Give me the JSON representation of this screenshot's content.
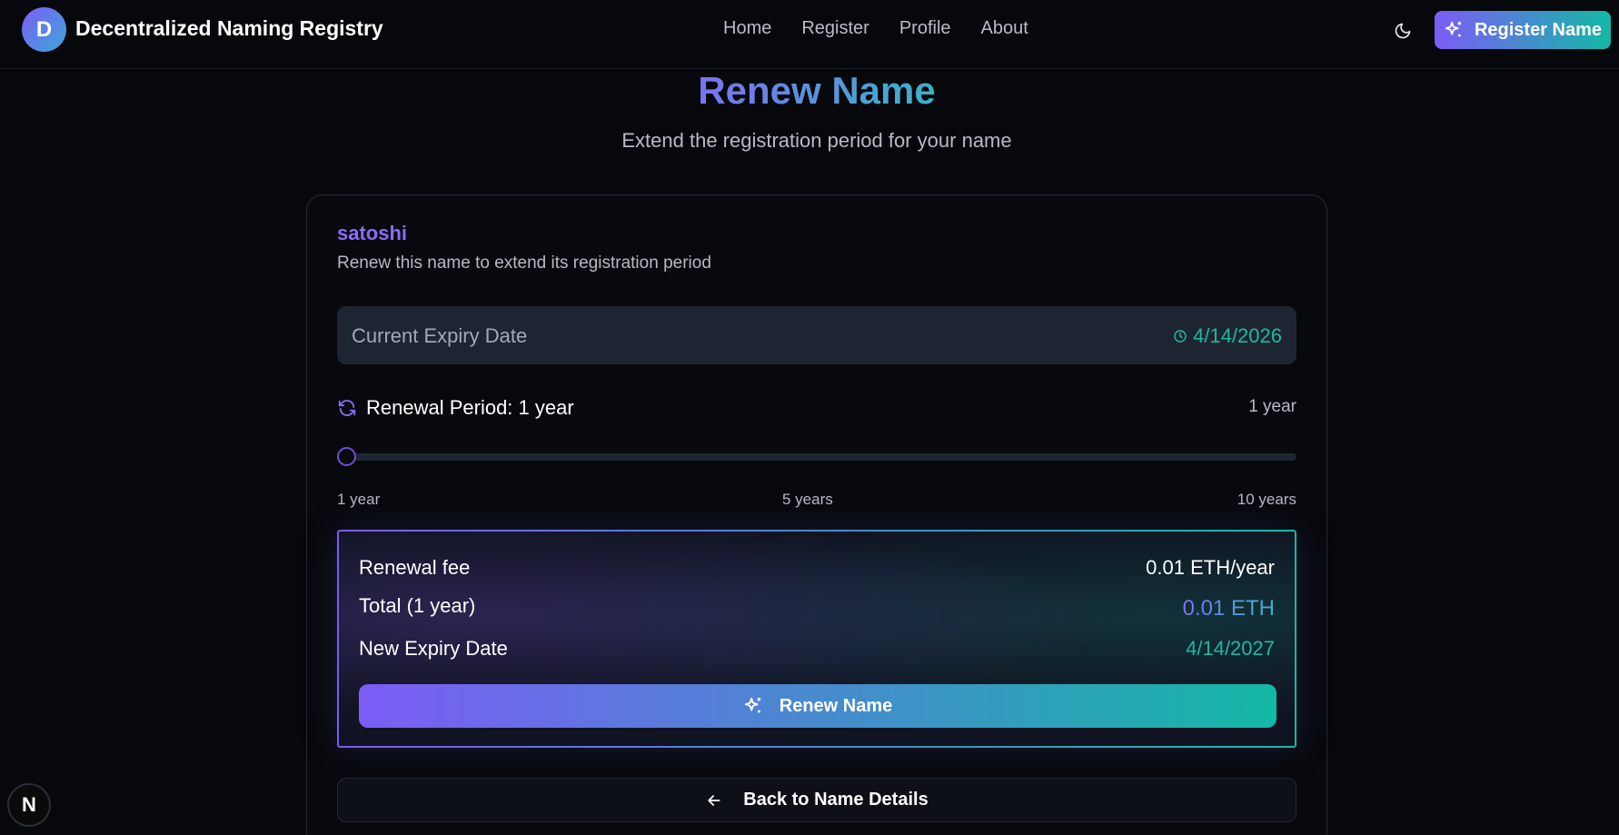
{
  "header": {
    "logo_letter": "D",
    "brand": "Decentralized Naming Registry",
    "nav": [
      "Home",
      "Register",
      "Profile",
      "About"
    ],
    "theme_icon": "moon-icon",
    "register_label": "Register Name",
    "register_icon": "sparkles-icon"
  },
  "hero": {
    "title": "Renew Name",
    "subtitle": "Extend the registration period for your name"
  },
  "card": {
    "name": "satoshi",
    "description": "Renew this name to extend its registration period",
    "expiry": {
      "label": "Current Expiry Date",
      "value": "4/14/2026",
      "icon": "clock-icon"
    },
    "period": {
      "label": "Renewal Period: 1 year",
      "value_right": "1 year",
      "icon": "refresh-icon",
      "slider_value": 1,
      "slider_min": 1,
      "slider_max": 10,
      "ticks": [
        "1 year",
        "5 years",
        "10 years"
      ]
    },
    "summary": {
      "fee_label": "Renewal fee",
      "fee_value": "0.01 ETH/year",
      "total_label": "Total (1 year)",
      "total_value": "0.01 ETH",
      "new_expiry_label": "New Expiry Date",
      "new_expiry_value": "4/14/2027",
      "renew_button": "Renew Name"
    },
    "back_button": "Back to Name Details"
  },
  "dev_badge": "N",
  "colors": {
    "accent_purple": "#7c5cf6",
    "accent_teal": "#14b8a6",
    "background": "#07080b"
  }
}
